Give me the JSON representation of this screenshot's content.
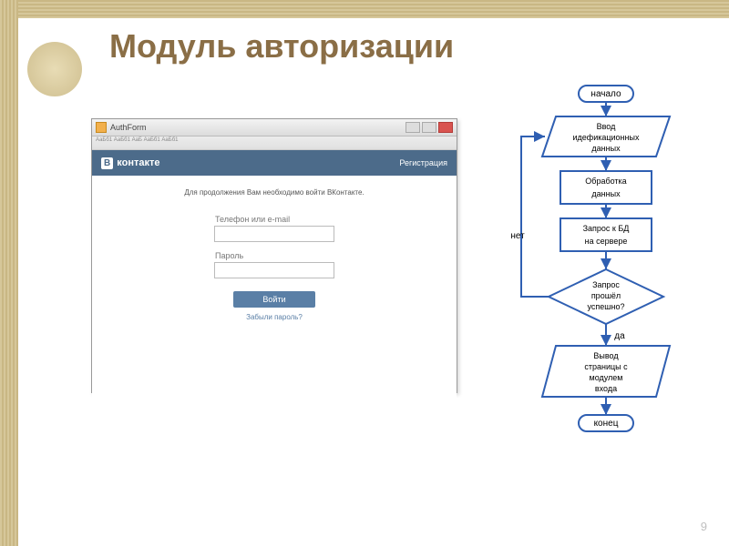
{
  "slide": {
    "title": "Модуль авторизации",
    "page_number": "9"
  },
  "screenshot": {
    "window_title": "AuthForm",
    "ribbon_hint": "АаБб1 АаБб1 АаБ АаБб1 АаБб1",
    "vk_logo_letter": "В",
    "vk_brand": "контакте",
    "registration_link": "Регистрация",
    "message": "Для продолжения Вам необходимо войти ВКонтакте.",
    "login_label": "Телефон или e-mail",
    "password_label": "Пароль",
    "submit_label": "Войти",
    "forgot_label": "Забыли пароль?"
  },
  "flowchart": {
    "start": "начало",
    "input": "Ввод идефикационных данных",
    "process": "Обработка данных",
    "db": "Запрос к БД на сервере",
    "decision": "Запрос прошёл успешно?",
    "output": "Вывод страницы с модулем входа",
    "end": "конец",
    "edge_no": "нет",
    "edge_yes": "да"
  }
}
